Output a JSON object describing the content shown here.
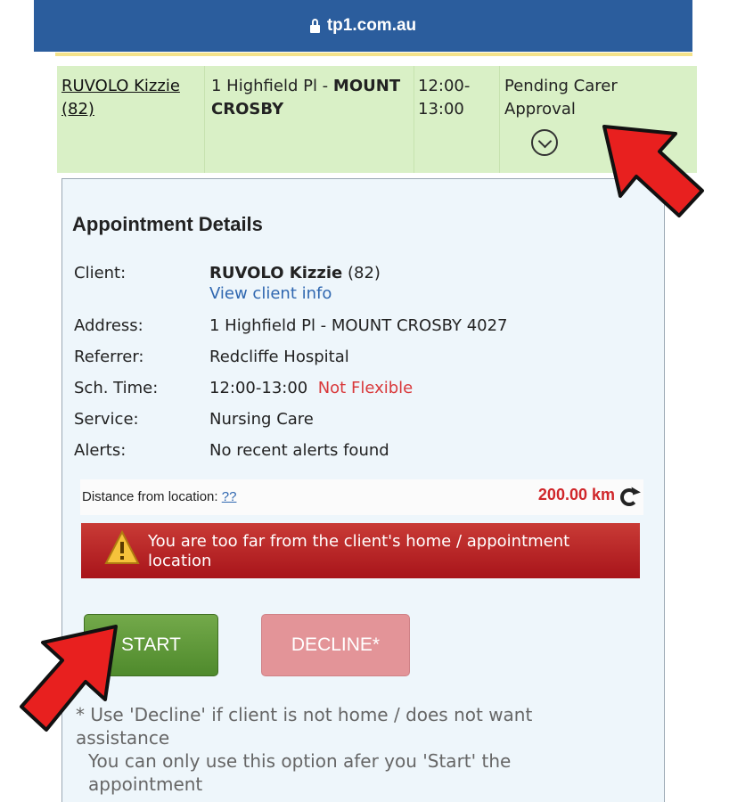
{
  "browser": {
    "url": "tp1.com.au"
  },
  "appointment_row": {
    "client_link": "RUVOLO Kizzie (82)",
    "address_line": "1 Highfield Pl -",
    "address_suburb": "MOUNT CROSBY",
    "time_start": "12:00-",
    "time_end": "13:00",
    "status": "Pending Carer Approval"
  },
  "details": {
    "title": "Appointment Details",
    "labels": {
      "client": "Client:",
      "address": "Address:",
      "referrer": "Referrer:",
      "sch_time": "Sch. Time:",
      "service": "Service:",
      "alerts": "Alerts:"
    },
    "client_name": "RUVOLO Kizzie",
    "client_age": "(82)",
    "view_client_info": "View client info",
    "address": "1 Highfield Pl - MOUNT CROSBY 4027",
    "referrer": "Redcliffe Hospital",
    "sch_time": "12:00-13:00",
    "flexibility": "Not Flexible",
    "service": "Nursing Care",
    "alerts": "No recent alerts found"
  },
  "distance": {
    "label": "Distance from location:",
    "help_link": "??",
    "value": "200.00 km"
  },
  "warning": {
    "text": "You are too far from the client's home / appointment location"
  },
  "buttons": {
    "start": "START",
    "decline": "DECLINE*"
  },
  "footnote": {
    "line1": "* Use 'Decline' if client is not home / does not want assistance",
    "line2": "You can only use this option afer you 'Start' the appointment"
  },
  "colors": {
    "header_blue": "#2b5d9d",
    "row_green": "#d9f0c6",
    "start_green": "#5a9636",
    "decline_pink": "#e39498",
    "warning_red": "#b82428",
    "annotation_arrow_red": "#e8201f"
  }
}
